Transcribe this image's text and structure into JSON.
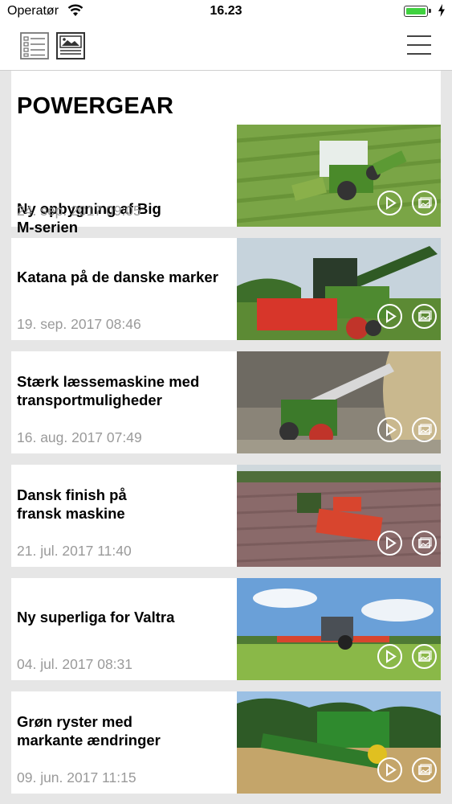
{
  "status": {
    "carrier": "Operatør",
    "time": "16.23",
    "battery_level": 1.0
  },
  "toolbar": {
    "list_view_icon": "list-view-icon",
    "article_view_icon": "article-view-icon",
    "menu_icon": "hamburger-menu-icon"
  },
  "section": {
    "title": "POWERGEAR"
  },
  "articles": [
    {
      "title_lines": [
        "Ny opbygning af Big",
        "M-serien"
      ],
      "date": "24. sep. 2017 09:05",
      "image": "green mower tractor on grass field"
    },
    {
      "title_lines": [
        "Katana på de danske marker"
      ],
      "date": "19. sep. 2017 08:46",
      "image": "green forage harvester with red header"
    },
    {
      "title_lines": [
        "Stærk læssemaskine med",
        "transportmuligheder"
      ],
      "date": "16. aug. 2017 07:49",
      "image": "green telehandler loading"
    },
    {
      "title_lines": [
        "Dansk finish på",
        "fransk maskine"
      ],
      "date": "21. jul. 2017 11:40",
      "image": "tractor with red seed drill on soil"
    },
    {
      "title_lines": [
        "Ny superliga for Valtra"
      ],
      "date": "04. jul. 2017 08:31",
      "image": "tractor with red mowers on field"
    },
    {
      "title_lines": [
        "Grøn ryster med",
        "markante ændringer"
      ],
      "date": "09. jun. 2017 11:15",
      "image": "green combine harvester in wheat"
    }
  ],
  "overlay_icons": {
    "video": "play-icon",
    "gallery": "gallery-icon"
  }
}
